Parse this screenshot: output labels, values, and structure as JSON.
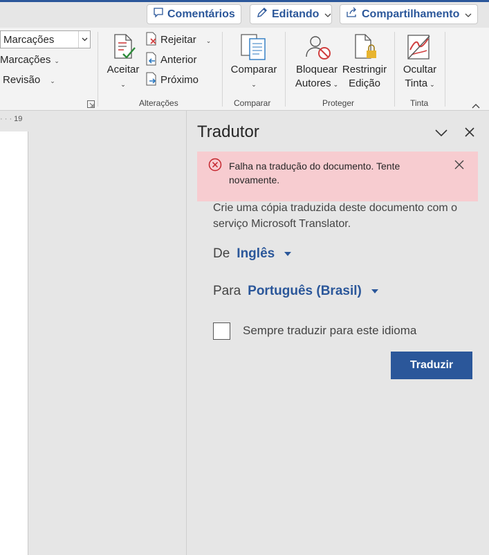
{
  "header": {
    "comments_label": "Comentários",
    "editing_label": "Editando",
    "share_label": "Compartilhamento"
  },
  "ribbon": {
    "markup_select_value": "Marcações",
    "show_markup_label": "Marcações",
    "review_pane_label": "Revisão",
    "accept_label": "Aceitar",
    "reject_label": "Rejeitar",
    "previous_label": "Anterior",
    "next_label": "Próximo",
    "changes_group": "Alterações",
    "compare_label": "Comparar",
    "compare_group": "Comparar",
    "block_authors_line1": "Bloquear",
    "block_authors_line2": "Autores",
    "restrict_editing_line1": "Restringir",
    "restrict_editing_line2": "Edição",
    "protect_group": "Proteger",
    "hide_ink_line1": "Ocultar",
    "hide_ink_line2": "Tinta",
    "ink_group": "Tinta"
  },
  "ruler": {
    "value": "19"
  },
  "translator": {
    "title": "Tradutor",
    "error_message": "Falha na tradução do documento. Tente novamente.",
    "description": "Crie uma cópia traduzida deste documento com o serviço Microsoft Translator.",
    "from_label": "De",
    "from_value": "Inglês",
    "to_label": "Para",
    "to_value": "Português (Brasil)",
    "always_translate_label": "Sempre traduzir para este idioma",
    "translate_button": "Traduzir"
  },
  "colors": {
    "accent": "#2b579a",
    "error_bg": "#f7ccd0",
    "error_icon": "#c4262e"
  }
}
